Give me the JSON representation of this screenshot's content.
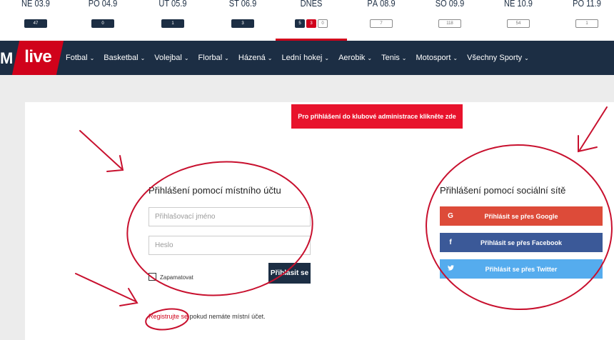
{
  "dates": [
    {
      "label": "NE 03.9",
      "badges": [
        {
          "text": "47",
          "style": "dark"
        }
      ]
    },
    {
      "label": "PO 04.9",
      "badges": [
        {
          "text": "0",
          "style": "dark"
        }
      ]
    },
    {
      "label": "ÚT 05.9",
      "badges": [
        {
          "text": "1",
          "style": "dark"
        }
      ]
    },
    {
      "label": "ST 06.9",
      "badges": [
        {
          "text": "3",
          "style": "dark"
        }
      ]
    },
    {
      "label": "DNES",
      "badges": [
        {
          "text": "5",
          "style": "dark"
        },
        {
          "text": "3",
          "style": "red"
        },
        {
          "text": "0",
          "style": "outline"
        }
      ]
    },
    {
      "label": "PÁ 08.9",
      "badges": [
        {
          "text": "7",
          "style": "outline"
        }
      ]
    },
    {
      "label": "SO 09.9",
      "badges": [
        {
          "text": "118",
          "style": "outline"
        }
      ]
    },
    {
      "label": "NE 10.9",
      "badges": [
        {
          "text": "54",
          "style": "outline"
        }
      ]
    },
    {
      "label": "PO 11.9",
      "badges": [
        {
          "text": "1",
          "style": "outline"
        }
      ]
    }
  ],
  "nav": {
    "brand_letter": "M",
    "logo_text": "live",
    "items": [
      "Fotbal",
      "Basketbal",
      "Volejbal",
      "Florbal",
      "Házená",
      "Lední hokej",
      "Aerobik",
      "Tenis",
      "Motosport",
      "Všechny Sporty"
    ],
    "chevron": "⌄"
  },
  "club_button": "Pro přihlášení do klubové administrace klikněte zde",
  "local_login": {
    "title": "Přihlášení pomocí místního účtu",
    "username_placeholder": "Přihlašovací jméno",
    "password_placeholder": "Heslo",
    "remember_label": "Zapamatovat",
    "submit_label": "Přihlásit se",
    "register_link": "Registrujte se",
    "register_suffix": " pokud nemáte místní účet."
  },
  "social_login": {
    "title": "Přihlášení pomocí sociální sítě",
    "google": {
      "icon": "G",
      "label": "Přihlásit se přes Google"
    },
    "facebook": {
      "icon": "f",
      "label": "Přihlásit se přes Facebook"
    },
    "twitter": {
      "icon": "🐦",
      "label": "Přihlásit se přes Twitter"
    }
  },
  "colors": {
    "navy": "#1c2e44",
    "brand_red": "#d0021b",
    "club_red": "#e8132c",
    "google": "#dd4b39",
    "facebook": "#3b5998",
    "twitter": "#55acee",
    "annotation": "#c8102e"
  }
}
